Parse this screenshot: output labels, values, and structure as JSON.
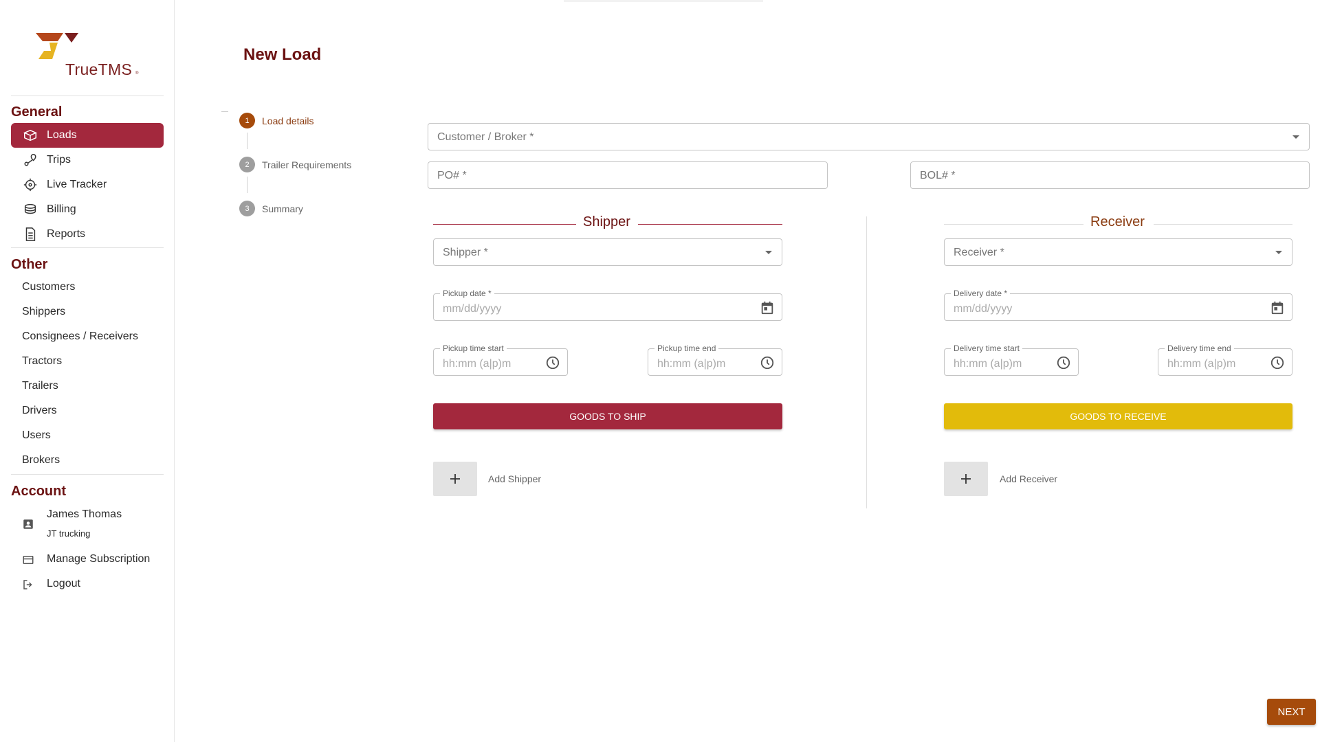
{
  "brand": {
    "name": "TrueTMS",
    "reg": "®",
    "primary": "#a3283d",
    "accent": "#e2bb0b",
    "dark": "#6b1212",
    "orange": "#a64b0b"
  },
  "sidebar": {
    "general_heading": "General",
    "general_items": [
      {
        "label": "Loads",
        "icon": "box-icon",
        "active": true
      },
      {
        "label": "Trips",
        "icon": "route-icon"
      },
      {
        "label": "Live Tracker",
        "icon": "target-icon"
      },
      {
        "label": "Billing",
        "icon": "coins-icon"
      },
      {
        "label": "Reports",
        "icon": "document-icon"
      }
    ],
    "other_heading": "Other",
    "other_items": [
      "Customers",
      "Shippers",
      "Consignees / Receivers",
      "Tractors",
      "Trailers",
      "Drivers",
      "Users",
      "Brokers"
    ],
    "account_heading": "Account",
    "user": {
      "name": "James Thomas",
      "company": "JT trucking"
    },
    "manage_subscription": "Manage Subscription",
    "logout": "Logout"
  },
  "page": {
    "title": "New Load"
  },
  "stepper": {
    "steps": [
      {
        "num": "1",
        "label": "Load details",
        "active": true
      },
      {
        "num": "2",
        "label": "Trailer Requirements"
      },
      {
        "num": "3",
        "label": "Summary"
      }
    ]
  },
  "form": {
    "customer_placeholder": "Customer / Broker *",
    "po_placeholder": "PO# *",
    "bol_placeholder": "BOL# *",
    "shipper": {
      "title": "Shipper",
      "select_placeholder": "Shipper *",
      "date_label": "Pickup date *",
      "date_placeholder": "mm/dd/yyyy",
      "time_start_label": "Pickup time start",
      "time_end_label": "Pickup time end",
      "time_placeholder": "hh:mm (a|p)m",
      "goods_button": "GOODS TO SHIP",
      "add_label": "Add Shipper"
    },
    "receiver": {
      "title": "Receiver",
      "select_placeholder": "Receiver *",
      "date_label": "Delivery date *",
      "date_placeholder": "mm/dd/yyyy",
      "time_start_label": "Delivery time start",
      "time_end_label": "Delivery time end",
      "time_placeholder": "hh:mm (a|p)m",
      "goods_button": "GOODS TO RECEIVE",
      "add_label": "Add Receiver"
    }
  },
  "actions": {
    "next": "NEXT"
  }
}
